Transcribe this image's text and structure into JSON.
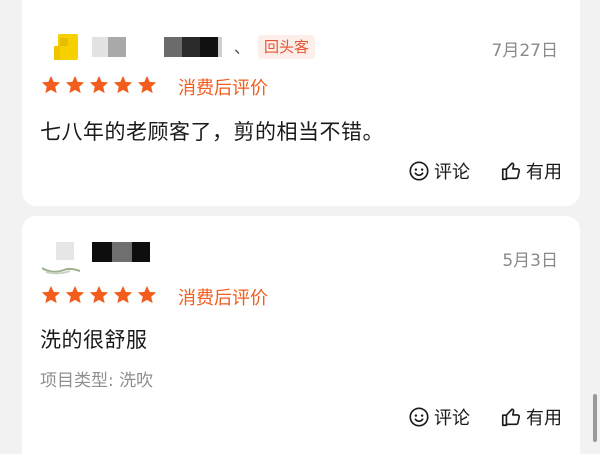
{
  "reviews": [
    {
      "badge": "回头客",
      "separator": "、",
      "date": "7月27日",
      "rating_label": "消费后评价",
      "stars": 5,
      "text": "七八年的老顾客了，剪的相当不错。",
      "project": "",
      "comment_label": "评论",
      "useful_label": "有用"
    },
    {
      "badge": "",
      "separator": "",
      "date": "5月3日",
      "rating_label": "消费后评价",
      "stars": 5,
      "text": "洗的很舒服",
      "project": "项目类型: 洗吹",
      "comment_label": "评论",
      "useful_label": "有用"
    }
  ],
  "icons": {
    "star": "star-icon",
    "comment": "comment-smile-icon",
    "thumb": "thumbs-up-icon"
  },
  "colors": {
    "star": "#f25c1c",
    "rating_label": "#f25c1c",
    "badge_text": "#e55533",
    "badge_bg": "#fdeee9",
    "date": "#8a8a8a",
    "meta": "#8f8f8f"
  }
}
